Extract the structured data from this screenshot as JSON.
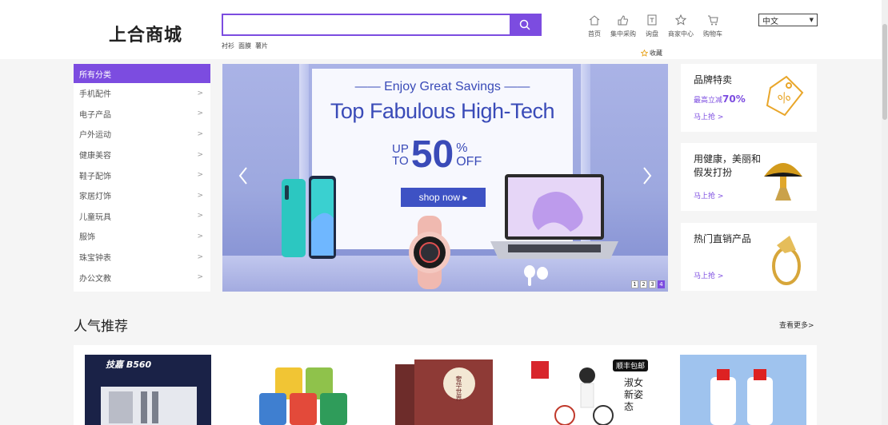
{
  "header": {
    "logo": "上合商城",
    "search": {
      "value": "",
      "placeholder": ""
    },
    "hot_words": [
      "衬衫",
      "面膜",
      "薯片"
    ],
    "nav": [
      {
        "label": "首页",
        "icon": "home-icon"
      },
      {
        "label": "集中采购",
        "icon": "thumbs-up-icon"
      },
      {
        "label": "询盘",
        "icon": "inquiry-icon"
      },
      {
        "label": "商家中心",
        "icon": "star-icon"
      },
      {
        "label": "购物车",
        "icon": "cart-icon"
      }
    ],
    "language": "中文",
    "favorite": "收藏"
  },
  "categories": {
    "title": "所有分类",
    "items": [
      "手机配件",
      "电子产品",
      "户外运动",
      "健康美容",
      "鞋子配饰",
      "家居灯饰",
      "儿童玩具",
      "服饰",
      "珠宝钟表",
      "办公文教"
    ]
  },
  "banner": {
    "line1": "Enjoy Great Savings",
    "line2": "Top Fabulous High-Tech",
    "up": "UP",
    "to": "TO",
    "percent": "50",
    "pct_sign": "%",
    "off": "OFF",
    "button": "shop now ▸",
    "pages": [
      "1",
      "2",
      "3",
      "4"
    ],
    "active_page": 4
  },
  "promos": [
    {
      "title": "品牌特卖",
      "sub_prefix": "最高立减",
      "sub_value": "70%",
      "link": "马上抢 >"
    },
    {
      "title": "用健康，美丽和假发打扮",
      "link": "马上抢 >"
    },
    {
      "title": "热门直销产品",
      "link": "马上抢 >"
    }
  ],
  "section": {
    "title": "人气推荐",
    "more": "查看更多>"
  },
  "products": [
    {
      "caption": "技嘉 B560"
    },
    {
      "caption": ""
    },
    {
      "caption": "奢华世界"
    },
    {
      "caption": "淑女新姿态",
      "badge": "顺丰包邮"
    },
    {
      "caption": ""
    }
  ],
  "colors": {
    "accent": "#7c4ce0",
    "banner_blue": "#3a4bb8"
  }
}
